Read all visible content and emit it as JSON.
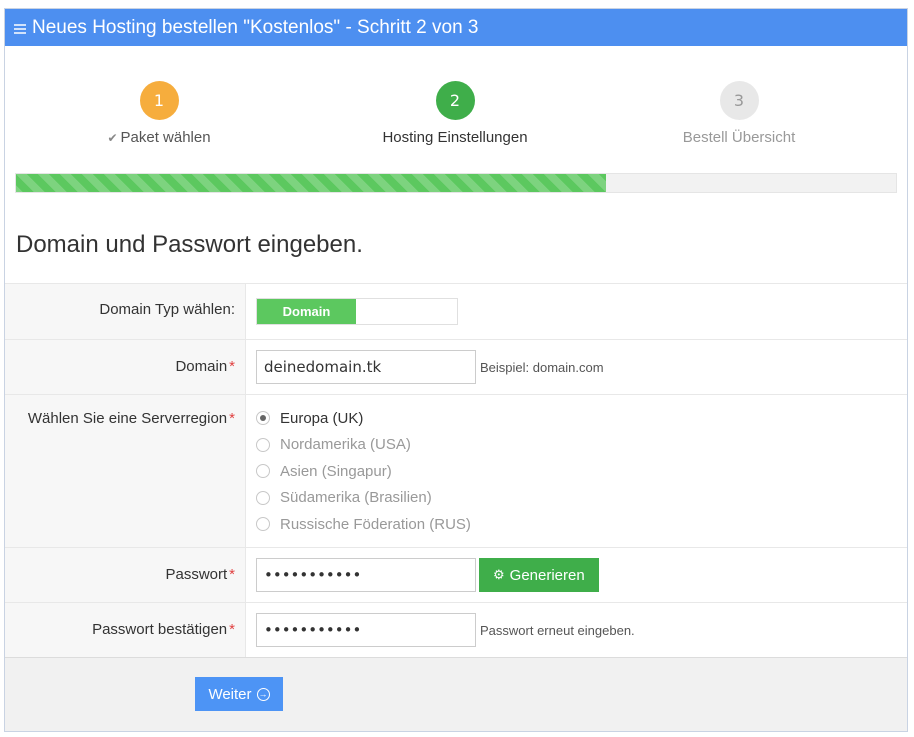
{
  "header": {
    "title": "Neues Hosting bestellen \"Kostenlos\" - Schritt 2 von 3",
    "icon": "menu-icon"
  },
  "steps": [
    {
      "number": "1",
      "label": "Paket wählen",
      "state": "done",
      "color": "#f6ad3d"
    },
    {
      "number": "2",
      "label": "Hosting Einstellungen",
      "state": "active",
      "color": "#3fae4a"
    },
    {
      "number": "3",
      "label": "Bestell Übersicht",
      "state": "pending",
      "color": "#e8e8e8"
    }
  ],
  "progress": {
    "percent": 67
  },
  "section_title": "Domain und Passwort eingeben.",
  "form": {
    "domain_type": {
      "label": "Domain Typ wählen:",
      "option": "Domain"
    },
    "domain": {
      "label": "Domain",
      "value": "deinedomain.tk",
      "hint": "Beispiel: domain.com"
    },
    "region": {
      "label": "Wählen Sie eine Serverregion",
      "options": [
        "Europa (UK)",
        "Nordamerika (USA)",
        "Asien (Singapur)",
        "Südamerika (Brasilien)",
        "Russische Föderation (RUS)"
      ],
      "selected": "Europa (UK)"
    },
    "password": {
      "label": "Passwort",
      "value": "•••••••••••",
      "button": "Generieren"
    },
    "password_confirm": {
      "label": "Passwort bestätigen",
      "value": "•••••••••••",
      "hint": "Passwort erneut eingeben."
    }
  },
  "footer": {
    "next_label": "Weiter"
  },
  "colors": {
    "header": "#4d8ff0",
    "success": "#3fae4a",
    "warning": "#f6ad3d",
    "primary": "#4d94f5"
  }
}
